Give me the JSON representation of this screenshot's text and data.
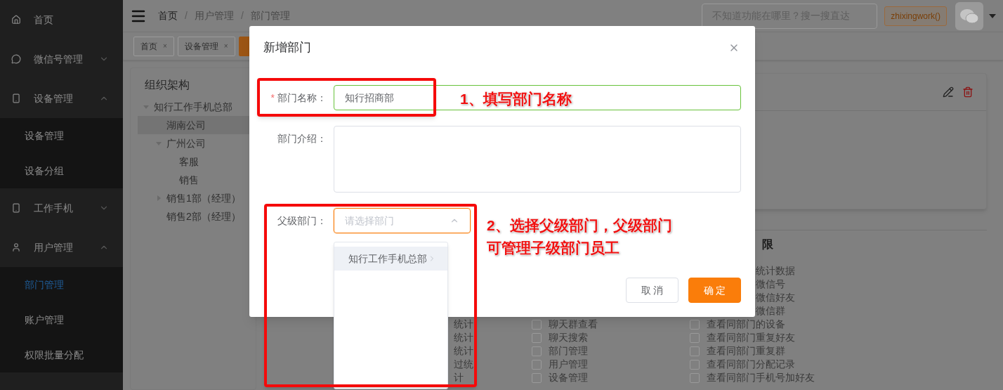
{
  "sidebar": {
    "items": [
      {
        "kind": "link",
        "label": "首页"
      },
      {
        "kind": "menu",
        "label": "微信号管理",
        "expanded": false
      },
      {
        "kind": "menu",
        "label": "设备管理",
        "expanded": true,
        "children": [
          {
            "label": "设备管理",
            "selected": false
          },
          {
            "label": "设备分组",
            "selected": false
          }
        ]
      },
      {
        "kind": "menu",
        "label": "工作手机",
        "expanded": false
      },
      {
        "kind": "menu",
        "label": "用户管理",
        "expanded": true,
        "children": [
          {
            "label": "部门管理",
            "selected": true
          },
          {
            "label": "账户管理",
            "selected": false
          },
          {
            "label": "权限批量分配",
            "selected": false
          }
        ]
      }
    ]
  },
  "header": {
    "breadcrumb": {
      "items": [
        "首页",
        "用户管理",
        "部门管理"
      ],
      "separators": [
        "/",
        "/"
      ]
    },
    "search": {
      "placeholder": "不知道功能在哪里？搜一搜直达"
    },
    "account": "zhixingwork()"
  },
  "tabs": [
    {
      "label": "首页",
      "close": "×",
      "selected": false
    },
    {
      "label": "设备管理",
      "close": "×",
      "selected": false
    },
    {
      "selected": true
    }
  ],
  "org_tree": {
    "title": "组织架构",
    "nodes": [
      {
        "label": "知行工作手机总部",
        "expanded": true,
        "selected": false,
        "children": [
          {
            "label": "湖南公司",
            "selected": true
          },
          {
            "label": "广州公司",
            "expanded": true,
            "selected": false,
            "children": [
              {
                "label": "客服",
                "selected": false
              },
              {
                "label": "销售",
                "selected": false
              }
            ]
          },
          {
            "label": "销售1部（经理）",
            "expanded": false,
            "selected": false
          },
          {
            "label": "销售2部（经理）",
            "selected": false
          }
        ]
      }
    ]
  },
  "permissions": {
    "title": "限",
    "columns": [
      {
        "items": [
          {
            "kind": "fragment",
            "label": "统计"
          },
          {
            "kind": "fragment",
            "label": "统计"
          },
          {
            "kind": "fragment",
            "label": "统计"
          },
          {
            "kind": "fragment",
            "label": "过统"
          },
          {
            "kind": "fragment",
            "label": "计"
          }
        ]
      },
      {
        "items": [
          {
            "kind": "checkbox",
            "label": "聊天群查看",
            "checked": false
          },
          {
            "kind": "checkbox",
            "label": "聊天搜索",
            "checked": false
          },
          {
            "kind": "checkbox",
            "label": "部门管理",
            "checked": false
          },
          {
            "kind": "checkbox",
            "label": "用户管理",
            "checked": false
          },
          {
            "kind": "checkbox",
            "label": "设备管理",
            "checked": false
          }
        ]
      },
      {
        "items": [
          {
            "kind": "fragment",
            "label": "统计数据"
          },
          {
            "kind": "fragment",
            "label": "微信号"
          },
          {
            "kind": "fragment",
            "label": "微信好友"
          },
          {
            "kind": "fragment",
            "label": "微信群"
          },
          {
            "kind": "checkbox",
            "label": "查看同部门的设备",
            "checked": false
          },
          {
            "kind": "checkbox",
            "label": "查看同部门重复好友",
            "checked": false
          },
          {
            "kind": "checkbox",
            "label": "查看同部门重复群",
            "checked": false
          },
          {
            "kind": "checkbox",
            "label": "查看同部门分配记录",
            "checked": false
          },
          {
            "kind": "checkbox",
            "label": "查看同部门手机号加好友",
            "checked": false
          }
        ]
      }
    ]
  },
  "dialog": {
    "title": "新增部门",
    "fields": [
      {
        "kind": "text",
        "label": "部门名称：",
        "required_mark": "*",
        "value": "知行招商部",
        "valid": true,
        "focused": false
      },
      {
        "kind": "textarea",
        "label": "部门介绍：",
        "valid": false,
        "focused": false
      },
      {
        "kind": "select",
        "label": "父级部门：",
        "placeholder": "请选择部门",
        "valid": false,
        "focused": true,
        "open": true,
        "options": [
          {
            "label": "知行工作手机总部",
            "has_children": true,
            "selected": true
          }
        ]
      }
    ],
    "buttons": [
      {
        "label": "取 消",
        "kind": "default"
      },
      {
        "label": "确 定",
        "kind": "primary"
      }
    ]
  },
  "annotations": [
    {
      "lines": [
        "1、填写部门名称"
      ]
    },
    {
      "lines": [
        "2、选择父级部门，父级部门",
        "可管理子级部门员工"
      ]
    }
  ]
}
